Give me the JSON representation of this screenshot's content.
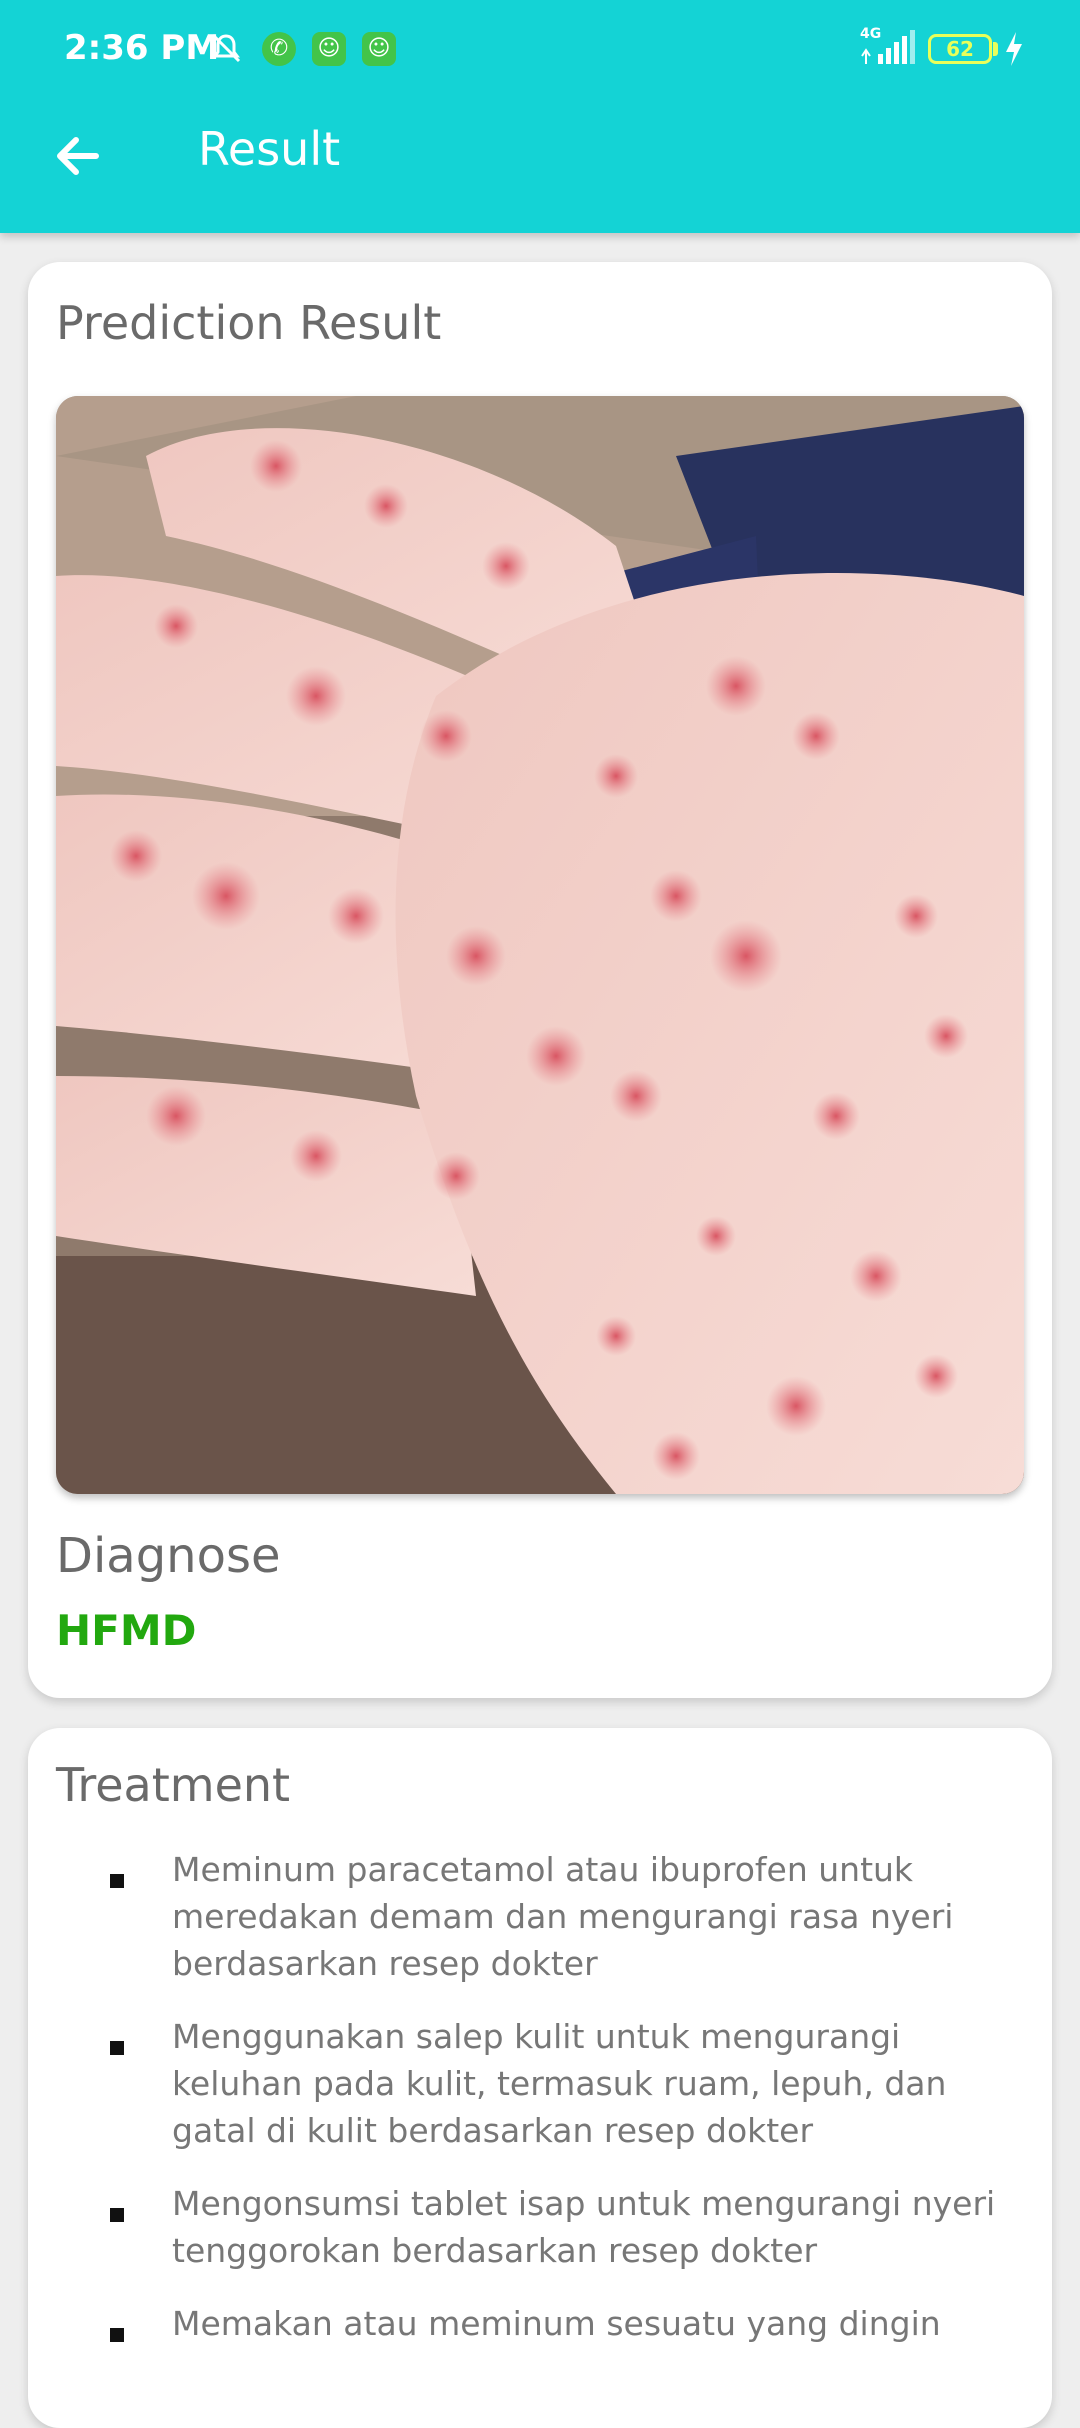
{
  "status_bar": {
    "time": "2:36 PM",
    "network": "4G",
    "battery": "62",
    "icons": [
      "mute-icon",
      "whatsapp-icon",
      "app-icon",
      "app-icon"
    ]
  },
  "app_bar": {
    "title": "Result",
    "back_icon": "arrow-left-icon"
  },
  "prediction_card": {
    "title": "Prediction Result",
    "image": "hand with red spots photo",
    "diagnose_label": "Diagnose",
    "diagnose_value": "HFMD"
  },
  "treatment_card": {
    "title": "Treatment",
    "items": [
      "Meminum paracetamol atau ibuprofen untuk meredakan demam dan mengurangi rasa nyeri berdasarkan resep dokter",
      "Menggunakan salep kulit untuk mengurangi keluhan pada kulit, termasuk ruam, lepuh, dan gatal di kulit berdasarkan resep dokter",
      "Mengonsumsi tablet isap untuk mengurangi nyeri tenggorokan berdasarkan resep dokter",
      "Memakan atau meminum sesuatu yang dingin"
    ]
  },
  "colors": {
    "primary": "#14d3d5",
    "diagnose": "#22a80f",
    "heading": "#6a6a6a",
    "body_text": "#777777",
    "background": "#eeeeee"
  }
}
